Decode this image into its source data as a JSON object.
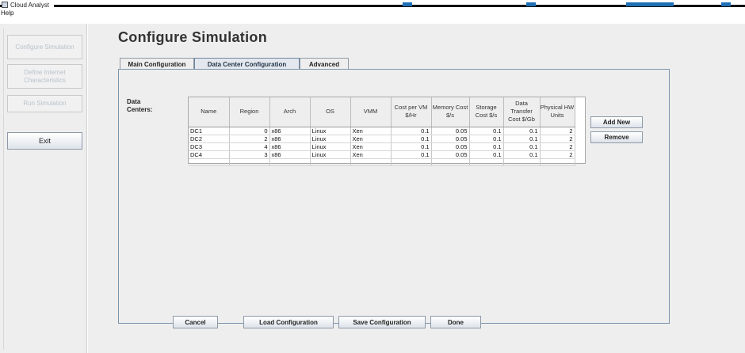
{
  "window": {
    "title": "Cloud Analyst",
    "menu": [
      "Help"
    ]
  },
  "colors": {
    "accent_blue": "#1f6fb5",
    "panel_bg": "#eeeeee",
    "tab_border": "#7d94ad"
  },
  "sidebar": {
    "items": [
      {
        "label": "Configure Simulation",
        "enabled": false
      },
      {
        "label": "Define Internet Characteristics",
        "enabled": false
      },
      {
        "label": "Run Simulation",
        "enabled": false
      }
    ],
    "exit_label": "Exit"
  },
  "main": {
    "title": "Configure Simulation",
    "tabs": [
      {
        "label": "Main Configuration",
        "selected": false
      },
      {
        "label": "Data Center Configuration",
        "selected": true
      },
      {
        "label": "Advanced",
        "selected": false
      }
    ],
    "data_centers_label": "Data Centers:",
    "table": {
      "headers": [
        "Name",
        "Region",
        "Arch",
        "OS",
        "VMM",
        "Cost per VM $/Hr",
        "Memory Cost $/s",
        "Storage Cost $/s",
        "Data Transfer Cost $/Gb",
        "Physical HW Units"
      ],
      "rows": [
        [
          "DC1",
          "0",
          "x86",
          "Linux",
          "Xen",
          "0.1",
          "0.05",
          "0.1",
          "0.1",
          "2"
        ],
        [
          "DC2",
          "2",
          "x86",
          "Linux",
          "Xen",
          "0.1",
          "0.05",
          "0.1",
          "0.1",
          "2"
        ],
        [
          "DC3",
          "4",
          "x86",
          "Linux",
          "Xen",
          "0.1",
          "0.05",
          "0.1",
          "0.1",
          "2"
        ],
        [
          "DC4",
          "3",
          "x86",
          "Linux",
          "Xen",
          "0.1",
          "0.05",
          "0.1",
          "0.1",
          "2"
        ]
      ]
    },
    "add_new_label": "Add New",
    "remove_label": "Remove",
    "buttons": {
      "cancel": "Cancel",
      "load": "Load Configuration",
      "save": "Save Configuration",
      "done": "Done"
    }
  }
}
